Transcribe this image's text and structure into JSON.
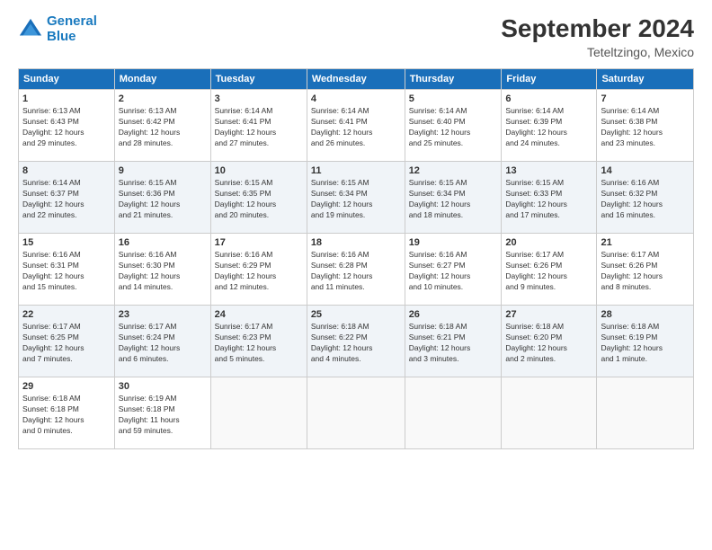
{
  "logo": {
    "line1": "General",
    "line2": "Blue"
  },
  "header": {
    "month": "September 2024",
    "location": "Teteltzingo, Mexico"
  },
  "weekdays": [
    "Sunday",
    "Monday",
    "Tuesday",
    "Wednesday",
    "Thursday",
    "Friday",
    "Saturday"
  ],
  "weeks": [
    [
      {
        "day": "1",
        "info": "Sunrise: 6:13 AM\nSunset: 6:43 PM\nDaylight: 12 hours\nand 29 minutes."
      },
      {
        "day": "2",
        "info": "Sunrise: 6:13 AM\nSunset: 6:42 PM\nDaylight: 12 hours\nand 28 minutes."
      },
      {
        "day": "3",
        "info": "Sunrise: 6:14 AM\nSunset: 6:41 PM\nDaylight: 12 hours\nand 27 minutes."
      },
      {
        "day": "4",
        "info": "Sunrise: 6:14 AM\nSunset: 6:41 PM\nDaylight: 12 hours\nand 26 minutes."
      },
      {
        "day": "5",
        "info": "Sunrise: 6:14 AM\nSunset: 6:40 PM\nDaylight: 12 hours\nand 25 minutes."
      },
      {
        "day": "6",
        "info": "Sunrise: 6:14 AM\nSunset: 6:39 PM\nDaylight: 12 hours\nand 24 minutes."
      },
      {
        "day": "7",
        "info": "Sunrise: 6:14 AM\nSunset: 6:38 PM\nDaylight: 12 hours\nand 23 minutes."
      }
    ],
    [
      {
        "day": "8",
        "info": "Sunrise: 6:14 AM\nSunset: 6:37 PM\nDaylight: 12 hours\nand 22 minutes."
      },
      {
        "day": "9",
        "info": "Sunrise: 6:15 AM\nSunset: 6:36 PM\nDaylight: 12 hours\nand 21 minutes."
      },
      {
        "day": "10",
        "info": "Sunrise: 6:15 AM\nSunset: 6:35 PM\nDaylight: 12 hours\nand 20 minutes."
      },
      {
        "day": "11",
        "info": "Sunrise: 6:15 AM\nSunset: 6:34 PM\nDaylight: 12 hours\nand 19 minutes."
      },
      {
        "day": "12",
        "info": "Sunrise: 6:15 AM\nSunset: 6:34 PM\nDaylight: 12 hours\nand 18 minutes."
      },
      {
        "day": "13",
        "info": "Sunrise: 6:15 AM\nSunset: 6:33 PM\nDaylight: 12 hours\nand 17 minutes."
      },
      {
        "day": "14",
        "info": "Sunrise: 6:16 AM\nSunset: 6:32 PM\nDaylight: 12 hours\nand 16 minutes."
      }
    ],
    [
      {
        "day": "15",
        "info": "Sunrise: 6:16 AM\nSunset: 6:31 PM\nDaylight: 12 hours\nand 15 minutes."
      },
      {
        "day": "16",
        "info": "Sunrise: 6:16 AM\nSunset: 6:30 PM\nDaylight: 12 hours\nand 14 minutes."
      },
      {
        "day": "17",
        "info": "Sunrise: 6:16 AM\nSunset: 6:29 PM\nDaylight: 12 hours\nand 12 minutes."
      },
      {
        "day": "18",
        "info": "Sunrise: 6:16 AM\nSunset: 6:28 PM\nDaylight: 12 hours\nand 11 minutes."
      },
      {
        "day": "19",
        "info": "Sunrise: 6:16 AM\nSunset: 6:27 PM\nDaylight: 12 hours\nand 10 minutes."
      },
      {
        "day": "20",
        "info": "Sunrise: 6:17 AM\nSunset: 6:26 PM\nDaylight: 12 hours\nand 9 minutes."
      },
      {
        "day": "21",
        "info": "Sunrise: 6:17 AM\nSunset: 6:26 PM\nDaylight: 12 hours\nand 8 minutes."
      }
    ],
    [
      {
        "day": "22",
        "info": "Sunrise: 6:17 AM\nSunset: 6:25 PM\nDaylight: 12 hours\nand 7 minutes."
      },
      {
        "day": "23",
        "info": "Sunrise: 6:17 AM\nSunset: 6:24 PM\nDaylight: 12 hours\nand 6 minutes."
      },
      {
        "day": "24",
        "info": "Sunrise: 6:17 AM\nSunset: 6:23 PM\nDaylight: 12 hours\nand 5 minutes."
      },
      {
        "day": "25",
        "info": "Sunrise: 6:18 AM\nSunset: 6:22 PM\nDaylight: 12 hours\nand 4 minutes."
      },
      {
        "day": "26",
        "info": "Sunrise: 6:18 AM\nSunset: 6:21 PM\nDaylight: 12 hours\nand 3 minutes."
      },
      {
        "day": "27",
        "info": "Sunrise: 6:18 AM\nSunset: 6:20 PM\nDaylight: 12 hours\nand 2 minutes."
      },
      {
        "day": "28",
        "info": "Sunrise: 6:18 AM\nSunset: 6:19 PM\nDaylight: 12 hours\nand 1 minute."
      }
    ],
    [
      {
        "day": "29",
        "info": "Sunrise: 6:18 AM\nSunset: 6:18 PM\nDaylight: 12 hours\nand 0 minutes."
      },
      {
        "day": "30",
        "info": "Sunrise: 6:19 AM\nSunset: 6:18 PM\nDaylight: 11 hours\nand 59 minutes."
      },
      null,
      null,
      null,
      null,
      null
    ]
  ]
}
